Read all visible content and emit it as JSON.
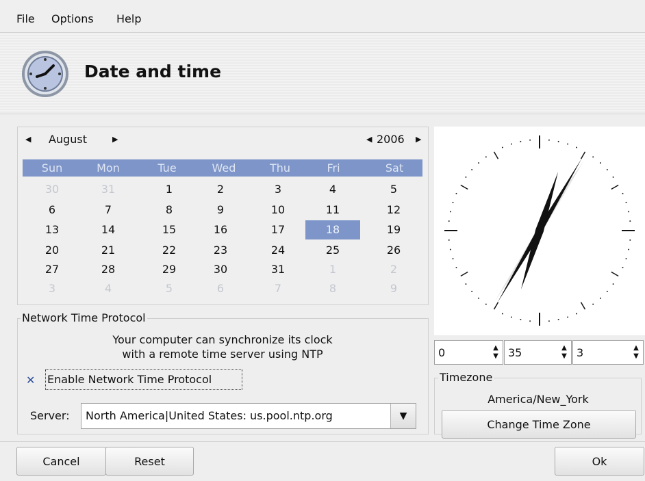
{
  "menubar": {
    "file": "File",
    "options": "Options",
    "help": "Help"
  },
  "header": {
    "title": "Date and time",
    "icon": "clock-icon"
  },
  "calendar": {
    "month": "August",
    "year": "2006",
    "day_names": [
      "Sun",
      "Mon",
      "Tue",
      "Wed",
      "Thu",
      "Fri",
      "Sat"
    ],
    "weeks": [
      [
        "30",
        "31",
        "1",
        "2",
        "3",
        "4",
        "5"
      ],
      [
        "6",
        "7",
        "8",
        "9",
        "10",
        "11",
        "12"
      ],
      [
        "13",
        "14",
        "15",
        "16",
        "17",
        "18",
        "19"
      ],
      [
        "20",
        "21",
        "22",
        "23",
        "24",
        "25",
        "26"
      ],
      [
        "27",
        "28",
        "29",
        "30",
        "31",
        "1",
        "2"
      ],
      [
        "3",
        "4",
        "5",
        "6",
        "7",
        "8",
        "9"
      ]
    ],
    "selected_day": "18"
  },
  "ntp": {
    "legend": "Network Time Protocol",
    "description_line1": "Your computer can synchronize its clock",
    "description_line2": "with a remote time server using NTP",
    "enable_label": "Enable Network Time Protocol",
    "enabled": true,
    "server_label": "Server:",
    "server_value": "North America|United States: us.pool.ntp.org"
  },
  "time": {
    "hours": "0",
    "minutes": "35",
    "seconds": "3"
  },
  "timezone": {
    "legend": "Timezone",
    "value": "America/New_York",
    "change_button": "Change Time Zone"
  },
  "buttons": {
    "cancel": "Cancel",
    "reset": "Reset",
    "ok": "Ok"
  },
  "colors": {
    "selection": "#7d95c8"
  }
}
